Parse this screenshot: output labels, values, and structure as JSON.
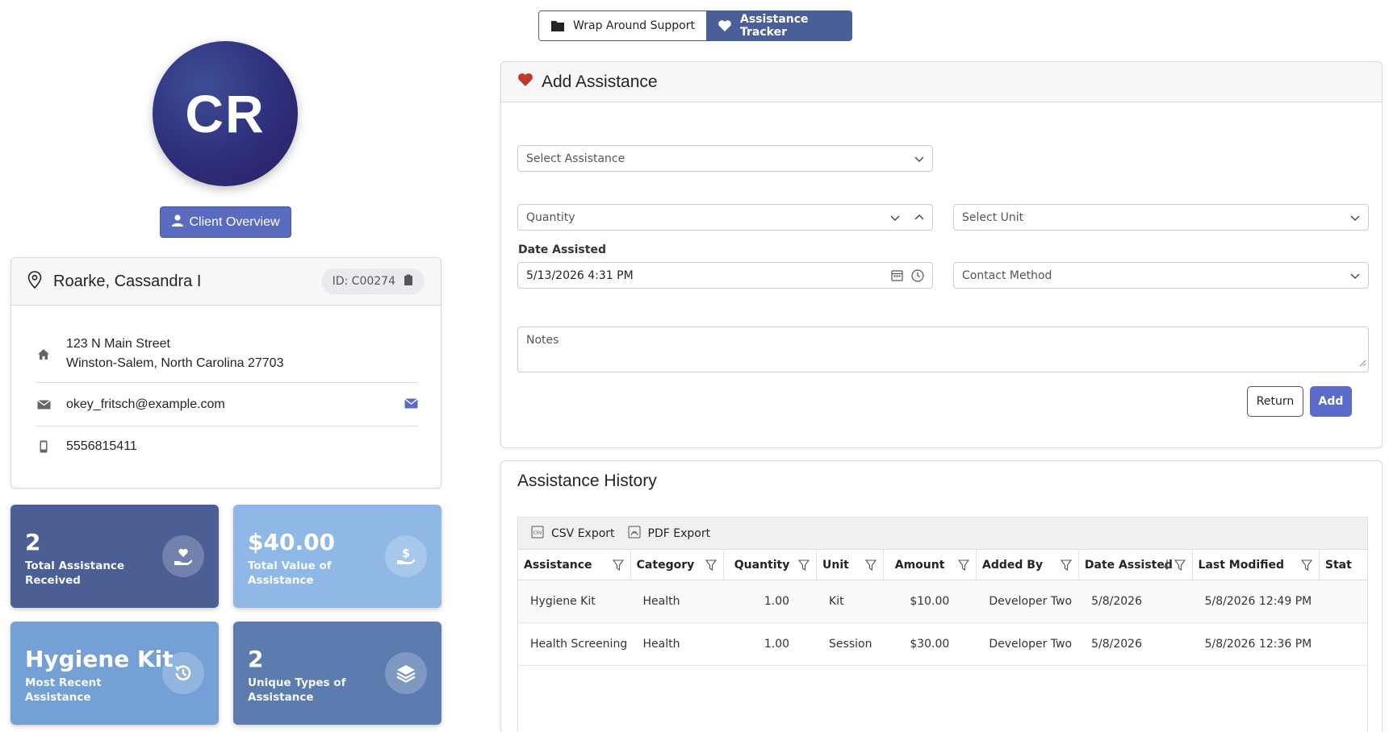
{
  "nav": {
    "tabs": [
      {
        "label": "Wrap Around Support",
        "icon": "folder-icon",
        "active": false
      },
      {
        "label": "Assistance Tracker",
        "icon": "heart-icon",
        "active": true
      }
    ]
  },
  "client": {
    "initials": "CR",
    "overview_button": "Client Overview",
    "name": "Roarke, Cassandra I",
    "id_label": "ID: C00274",
    "address_line1": "123 N Main Street",
    "address_line2": "Winston-Salem, North Carolina 27703",
    "email": "okey_fritsch@example.com",
    "phone": "5556815411"
  },
  "stats": [
    {
      "value": "2",
      "label_line1": "Total Assistance",
      "label_line2": "Received",
      "icon": "hand-heart-icon",
      "color": "#4b5f95"
    },
    {
      "value": "$40.00",
      "label_line1": "Total Value of",
      "label_line2": "Assistance",
      "icon": "hand-dollar-icon",
      "color": "#8fb8e6"
    },
    {
      "value": "Hygiene Kit",
      "label_line1": "Most Recent",
      "label_line2": "Assistance",
      "icon": "history-icon",
      "color": "#74a0d6"
    },
    {
      "value": "2",
      "label_line1": "Unique Types of",
      "label_line2": "Assistance",
      "icon": "layers-icon",
      "color": "#5c7cb0"
    }
  ],
  "add_assistance": {
    "title": "Add Assistance",
    "select_assistance_placeholder": "Select Assistance",
    "quantity_placeholder": "Quantity",
    "select_unit_placeholder": "Select Unit",
    "date_label": "Date Assisted",
    "date_value": "5/13/2026 4:31 PM",
    "contact_method_placeholder": "Contact Method",
    "notes_placeholder": "Notes",
    "return_label": "Return",
    "add_label": "Add"
  },
  "history": {
    "title": "Assistance History",
    "csv_export": "CSV Export",
    "pdf_export": "PDF Export",
    "columns": [
      "Assistance",
      "Category",
      "Quantity",
      "Unit",
      "Amount",
      "Added By",
      "Date Assisted",
      "Last Modified",
      "Stat"
    ],
    "rows": [
      [
        "Hygiene Kit",
        "Health",
        "1.00",
        "Kit",
        "$10.00",
        "Developer Two",
        "5/8/2026",
        "5/8/2026 12:49 PM",
        ""
      ],
      [
        "Health Screening",
        "Health",
        "1.00",
        "Session",
        "$30.00",
        "Developer Two",
        "5/8/2026",
        "5/8/2026 12:36 PM",
        ""
      ]
    ]
  },
  "colors": {
    "accent": "#5b6bbf",
    "nav_active": "#4a5f98",
    "heart": "#c0392b"
  }
}
